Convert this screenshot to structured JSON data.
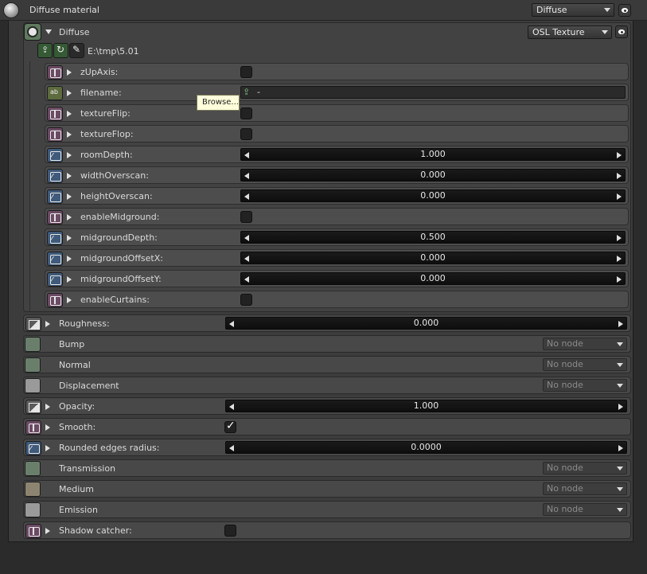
{
  "header": {
    "title": "Diffuse material",
    "type_dropdown": "Diffuse"
  },
  "diffuse": {
    "label": "Diffuse",
    "dropdown": "OSL Texture",
    "path": "E:\\tmp\\5.01"
  },
  "osl_params": [
    {
      "label": "zUpAxis:",
      "kind": "check",
      "pin": "tex",
      "value": ""
    },
    {
      "label": "filename:",
      "kind": "file",
      "pin": "str",
      "value": "-"
    },
    {
      "label": "textureFlip:",
      "kind": "check",
      "pin": "tex",
      "value": ""
    },
    {
      "label": "textureFlop:",
      "kind": "check",
      "pin": "tex",
      "value": ""
    },
    {
      "label": "roomDepth:",
      "kind": "slider",
      "pin": "float",
      "value": "1.000"
    },
    {
      "label": "widthOverscan:",
      "kind": "slider",
      "pin": "float",
      "value": "0.000"
    },
    {
      "label": "heightOverscan:",
      "kind": "slider",
      "pin": "float",
      "value": "0.000"
    },
    {
      "label": "enableMidground:",
      "kind": "check",
      "pin": "tex",
      "value": ""
    },
    {
      "label": "midgroundDepth:",
      "kind": "slider",
      "pin": "float",
      "value": "0.500"
    },
    {
      "label": "midgroundOffsetX:",
      "kind": "slider",
      "pin": "float",
      "value": "0.000"
    },
    {
      "label": "midgroundOffsetY:",
      "kind": "slider",
      "pin": "float",
      "value": "0.000"
    },
    {
      "label": "enableCurtains:",
      "kind": "check",
      "pin": "tex",
      "value": ""
    }
  ],
  "tooltip": "Browse...",
  "material_params": [
    {
      "label": "Roughness:",
      "kind": "slider",
      "pin": "grad",
      "value": "0.000",
      "arrow": true
    },
    {
      "label": "Bump",
      "kind": "node",
      "pin": "green",
      "value": "No node",
      "arrow": false
    },
    {
      "label": "Normal",
      "kind": "node",
      "pin": "green",
      "value": "No node",
      "arrow": false
    },
    {
      "label": "Displacement",
      "kind": "node",
      "pin": "gray",
      "value": "No node",
      "arrow": false
    },
    {
      "label": "Opacity:",
      "kind": "slider",
      "pin": "grad",
      "value": "1.000",
      "arrow": true
    },
    {
      "label": "Smooth:",
      "kind": "check",
      "pin": "tex",
      "value": "✓",
      "arrow": true
    },
    {
      "label": "Rounded edges radius:",
      "kind": "slider",
      "pin": "float",
      "value": "0.0000",
      "arrow": true
    },
    {
      "label": "Transmission",
      "kind": "node",
      "pin": "green",
      "value": "No node",
      "arrow": false
    },
    {
      "label": "Medium",
      "kind": "node",
      "pin": "sand",
      "value": "No node",
      "arrow": false
    },
    {
      "label": "Emission",
      "kind": "node",
      "pin": "gray",
      "value": "No node",
      "arrow": false
    },
    {
      "label": "Shadow catcher:",
      "kind": "check",
      "pin": "tex",
      "value": "",
      "arrow": true
    }
  ]
}
